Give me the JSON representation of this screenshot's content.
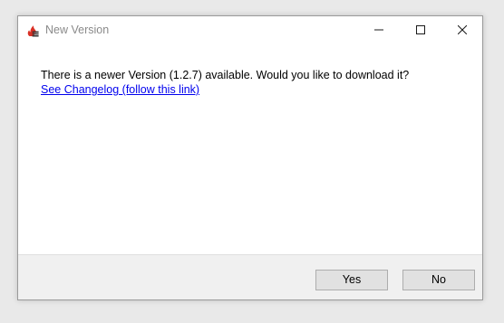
{
  "window": {
    "title": "New Version",
    "icon": "flame-app-icon",
    "controls": [
      "minimize-icon",
      "maximize-icon",
      "close-icon"
    ]
  },
  "dialog": {
    "message": "There is a newer Version (1.2.7) available. Would you like to download it?",
    "link_text": "See Changelog (follow this link)"
  },
  "buttons": {
    "yes_label": "Yes",
    "no_label": "No"
  },
  "colors": {
    "link": "#0000ee",
    "title_text": "#8a8a8a",
    "icon_red": "#d93025",
    "footer_bg": "#f0f0f0",
    "button_bg": "#e1e1e1",
    "button_border": "#adadad"
  }
}
